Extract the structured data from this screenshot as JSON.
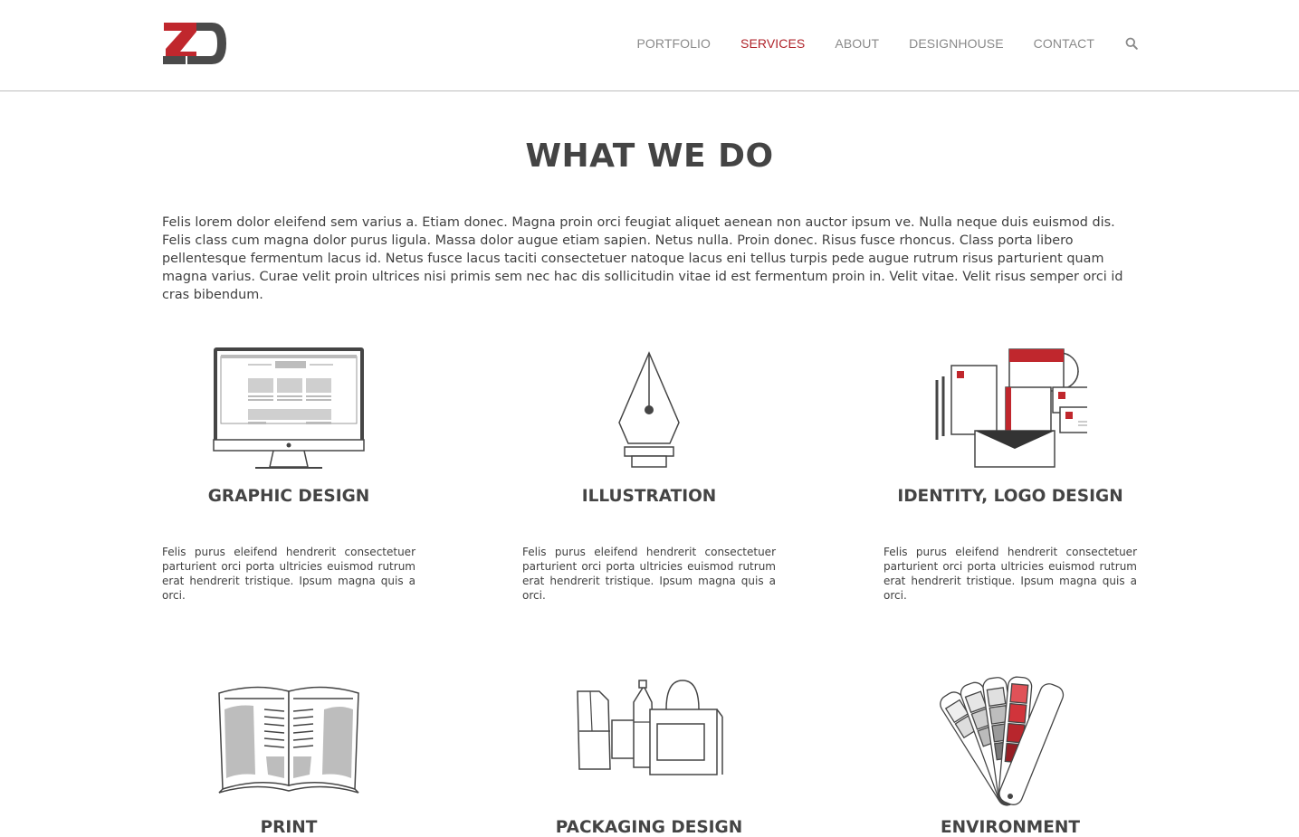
{
  "header": {
    "nav": [
      {
        "label": "PORTFOLIO",
        "active": false
      },
      {
        "label": "SERVICES",
        "active": true
      },
      {
        "label": "ABOUT",
        "active": false
      },
      {
        "label": "DESIGNHOUSE",
        "active": false
      },
      {
        "label": "CONTACT",
        "active": false
      }
    ],
    "search_icon": "search-icon",
    "logo_icon": "zd-logo"
  },
  "main": {
    "title": "WHAT WE DO",
    "intro": "Felis lorem dolor eleifend sem varius a. Etiam donec. Magna proin orci feugiat aliquet aenean non auctor ipsum ve. Nulla neque duis euismod dis. Felis class cum magna dolor purus ligula. Massa dolor augue etiam sapien. Netus nulla. Proin donec. Risus fusce rhoncus. Class porta libero pellentesque fermentum lacus id. Netus fusce lacus taciti consectetuer natoque lacus eni tellus turpis pede augue rutrum risus parturient quam magna varius. Curae velit proin ultrices nisi primis sem nec hac dis sollicitudin vitae id est fermentum proin in. Velit vitae. Velit risus semper orci id cras bibendum.",
    "services": [
      {
        "title": "GRAPHIC DESIGN",
        "text": "Felis purus eleifend hendrerit consectetuer parturient orci porta ultricies euismod rutrum erat hendrerit tristique. Ipsum magna quis a orci.",
        "icon": "monitor-icon"
      },
      {
        "title": "ILLUSTRATION",
        "text": "Felis purus eleifend hendrerit consectetuer parturient orci porta ultricies euismod rutrum erat hendrerit tristique. Ipsum magna quis a orci.",
        "icon": "pen-nib-icon"
      },
      {
        "title": "IDENTITY, LOGO DESIGN",
        "text": "Felis purus eleifend hendrerit consectetuer parturient orci porta ultricies euismod rutrum erat hendrerit tristique. Ipsum magna quis a orci.",
        "icon": "stationery-icon"
      },
      {
        "title": "PRINT",
        "icon": "open-book-icon"
      },
      {
        "title": "PACKAGING DESIGN",
        "icon": "packaging-icon"
      },
      {
        "title": "ENVIRONMENT",
        "icon": "color-swatch-icon"
      }
    ]
  },
  "colors": {
    "accent": "#b0252c",
    "text": "#3f3f3f",
    "nav": "#8a8a8a"
  }
}
